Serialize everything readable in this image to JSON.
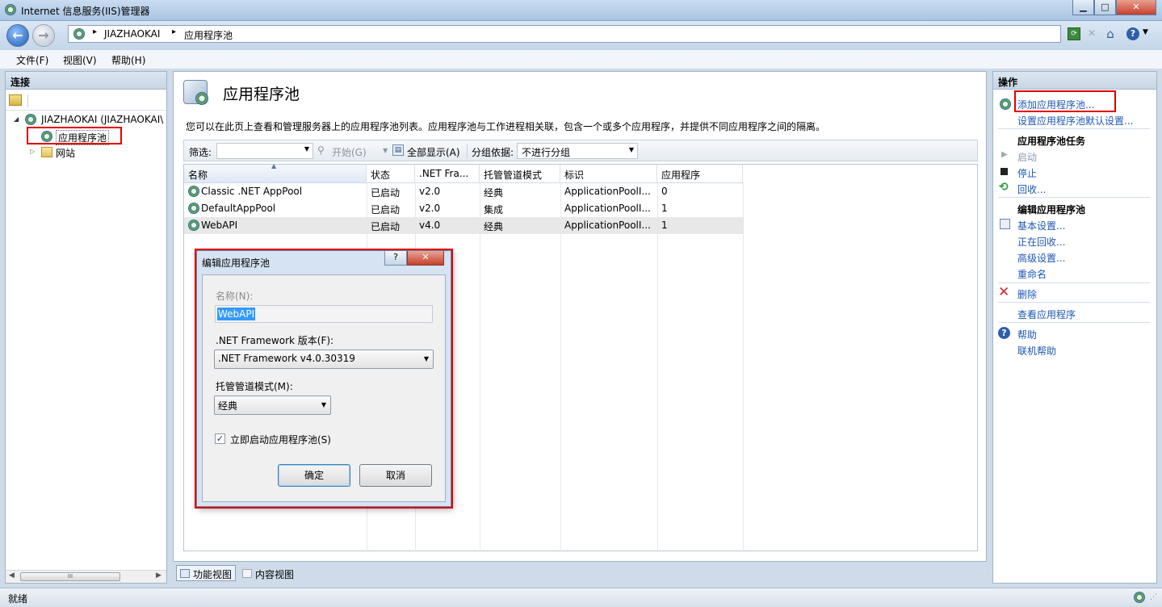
{
  "window": {
    "title": "Internet 信息服务(IIS)管理器"
  },
  "address": {
    "segments": [
      "JIAZHAOKAI",
      "应用程序池"
    ]
  },
  "menu": [
    "文件(F)",
    "视图(V)",
    "帮助(H)"
  ],
  "left_pane": {
    "header": "连接",
    "tree": {
      "server": "JIAZHAOKAI (JIAZHAOKAI\\",
      "app_pools": "应用程序池",
      "sites": "网站"
    }
  },
  "center": {
    "title": "应用程序池",
    "description": "您可以在此页上查看和管理服务器上的应用程序池列表。应用程序池与工作进程相关联，包含一个或多个应用程序，并提供不同应用程序之间的隔离。",
    "toolbar": {
      "filter_label": "筛选:",
      "start_label": "开始(G)",
      "show_all_label": "全部显示(A)",
      "group_label": "分组依据:",
      "group_value": "不进行分组"
    },
    "columns": [
      "名称",
      "状态",
      ".NET Fra...",
      "托管管道模式",
      "标识",
      "应用程序"
    ],
    "rows": [
      {
        "name": "Classic .NET AppPool",
        "status": "已启动",
        "net": "v2.0",
        "mode": "经典",
        "identity": "ApplicationPoolI...",
        "apps": "0"
      },
      {
        "name": "DefaultAppPool",
        "status": "已启动",
        "net": "v2.0",
        "mode": "集成",
        "identity": "ApplicationPoolI...",
        "apps": "1"
      },
      {
        "name": "WebAPI",
        "status": "已启动",
        "net": "v4.0",
        "mode": "经典",
        "identity": "ApplicationPoolI...",
        "apps": "1"
      }
    ],
    "tabs": {
      "features": "功能视图",
      "content": "内容视图"
    }
  },
  "right_pane": {
    "header": "操作",
    "add_pool": "添加应用程序池...",
    "set_defaults": "设置应用程序池默认设置...",
    "tasks_header": "应用程序池任务",
    "start": "启动",
    "stop": "停止",
    "recycle": "回收...",
    "edit_header": "编辑应用程序池",
    "basic_settings": "基本设置...",
    "recycling": "正在回收...",
    "advanced": "高级设置...",
    "rename": "重命名",
    "delete": "删除",
    "view_apps": "查看应用程序",
    "help": "帮助",
    "online_help": "联机帮助"
  },
  "dialog": {
    "title": "编辑应用程序池",
    "help_btn": "?",
    "close_btn": "✕",
    "name_label": "名称(N):",
    "name_value": "WebAPI",
    "framework_label": ".NET Framework 版本(F):",
    "framework_value": ".NET Framework v4.0.30319",
    "pipeline_label": "托管管道模式(M):",
    "pipeline_value": "经典",
    "autostart_label": "立即启动应用程序池(S)",
    "autostart_checked": true,
    "ok": "确定",
    "cancel": "取消"
  },
  "status": {
    "text": "就绪"
  }
}
